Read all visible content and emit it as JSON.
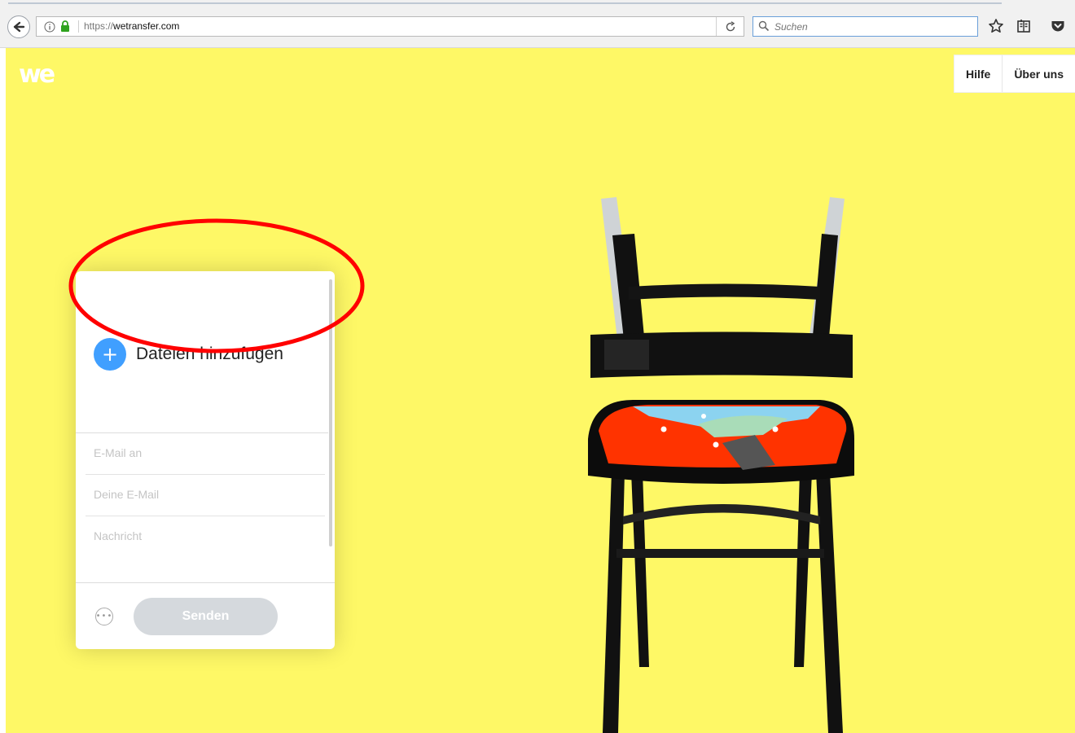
{
  "browser": {
    "url_protocol": "https://",
    "url_host": "wetransfer.com",
    "search_placeholder": "Suchen"
  },
  "site": {
    "logo": "we",
    "nav": [
      {
        "label": "Hilfe"
      },
      {
        "label": "Über uns"
      }
    ]
  },
  "transfer": {
    "add_files_label": "Dateien hinzufügen",
    "email_to_placeholder": "E-Mail an",
    "your_email_placeholder": "Deine E-Mail",
    "message_placeholder": "Nachricht",
    "send_label": "Senden"
  },
  "colors": {
    "background": "#fef866",
    "accent_blue": "#409fff",
    "annotation_red": "#ff0000"
  },
  "icons": [
    "back-arrow-icon",
    "info-icon",
    "lock-icon",
    "reload-icon",
    "search-icon",
    "bookmark-star-icon",
    "reading-list-icon",
    "pocket-icon",
    "plus-icon",
    "more-options-icon"
  ]
}
